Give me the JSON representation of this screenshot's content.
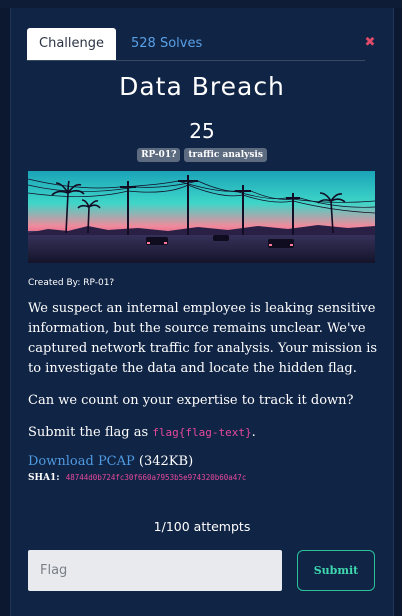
{
  "tabs": {
    "challenge_label": "Challenge",
    "solves_label": "528 Solves"
  },
  "close_glyph": "✖",
  "challenge": {
    "name": "Data Breach",
    "points": "25",
    "tags": [
      "RP-01?",
      "traffic analysis"
    ],
    "created_by_label": "Created By:",
    "created_by": "RP-01?",
    "description": [
      "We suspect an internal employee is leaking sensitive information, but the source remains unclear. We've captured network traffic for analysis. Your mission is to investigate the data and locate the hidden flag.",
      "Can we count on your expertise to track it down?"
    ],
    "submit_prefix": "Submit the flag as",
    "flag_format": "flag{flag-text}",
    "submit_suffix": "."
  },
  "download": {
    "link_label": "Download PCAP",
    "size": "(342KB)",
    "sha_label": "SHA1:",
    "sha_value": "48744d0b724fc30f660a7953b5e974320b60a47c"
  },
  "attempts": "1/100 attempts",
  "form": {
    "flag_placeholder": "Flag",
    "submit_label": "Submit"
  },
  "colors": {
    "background": "#0b1830",
    "modal": "#102445",
    "accent_link": "#4f9ae0",
    "accent_code": "#e5499b",
    "submit_border": "#2bbf9a",
    "close": "#e24a6a"
  }
}
